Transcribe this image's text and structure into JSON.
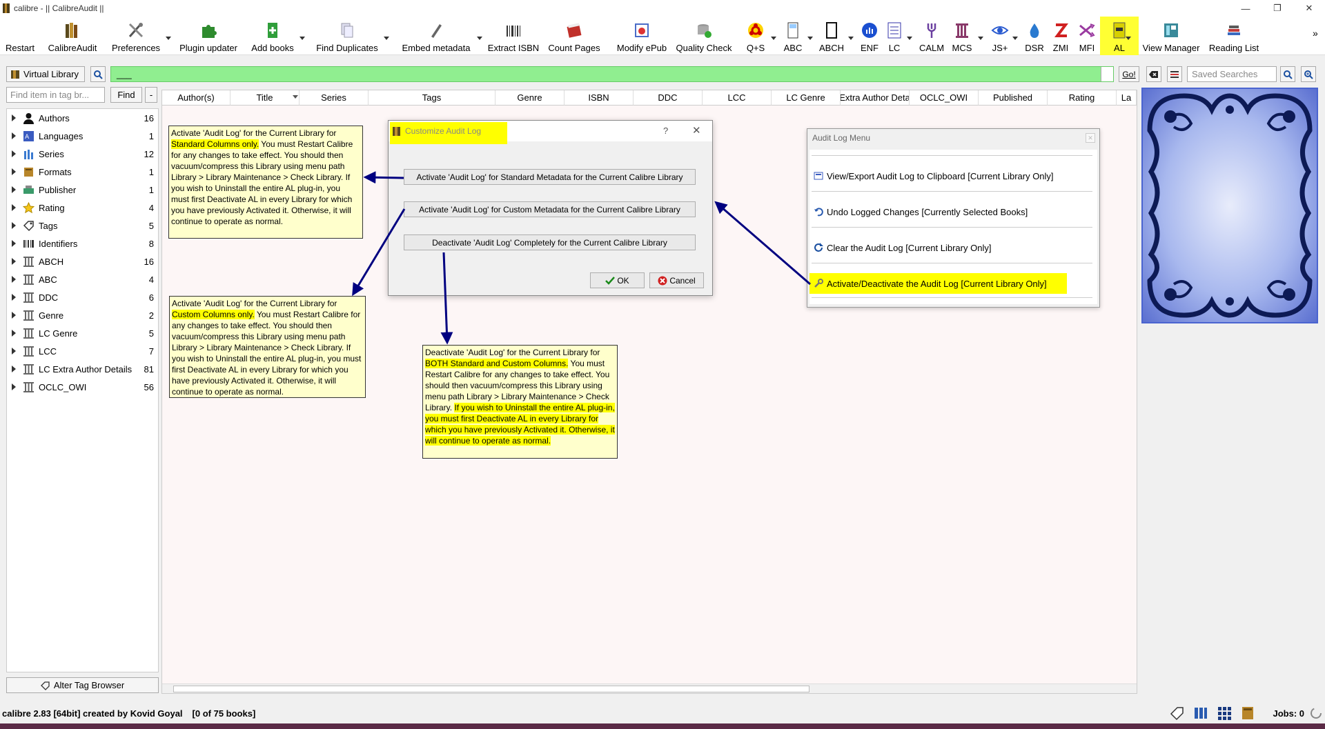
{
  "window": {
    "title": "calibre - || CalibreAudit ||",
    "controls": [
      "—",
      "❐",
      "✕"
    ]
  },
  "toolbar": {
    "restart": "Restart",
    "calibreaudit": "CalibreAudit",
    "preferences": "Preferences",
    "plugin_updater": "Plugin updater",
    "add_books": "Add books",
    "find_duplicates": "Find Duplicates",
    "embed_metadata": "Embed metadata",
    "extract_isbn": "Extract ISBN",
    "count_pages": "Count Pages",
    "modify_epub": "Modify ePub",
    "quality_check": "Quality Check",
    "qs": "Q+S",
    "abc": "ABC",
    "abch": "ABCH",
    "enf": "ENF",
    "lc": "LC",
    "calm": "CALM",
    "mcs": "MCS",
    "js": "JS+",
    "dsr": "DSR",
    "zmi": "ZMI",
    "mfi": "MFI",
    "al": "AL",
    "view_manager": "View Manager",
    "reading_list": "Reading List",
    "overflow": "»"
  },
  "search": {
    "virtual_library": "Virtual Library",
    "query": "___",
    "go": "Go!",
    "saved_placeholder": "Saved Searches"
  },
  "tagbrowser": {
    "find_placeholder": "Find item in tag br...",
    "find": "Find",
    "minus": "-",
    "alter": "Alter Tag Browser",
    "items": [
      {
        "label": "Authors",
        "count": "16",
        "icon": "person-icon"
      },
      {
        "label": "Languages",
        "count": "1",
        "icon": "language-icon"
      },
      {
        "label": "Series",
        "count": "12",
        "icon": "series-icon"
      },
      {
        "label": "Formats",
        "count": "1",
        "icon": "book-icon"
      },
      {
        "label": "Publisher",
        "count": "1",
        "icon": "publisher-icon"
      },
      {
        "label": "Rating",
        "count": "4",
        "icon": "star-icon"
      },
      {
        "label": "Tags",
        "count": "5",
        "icon": "tag-icon"
      },
      {
        "label": "Identifiers",
        "count": "8",
        "icon": "barcode-icon"
      },
      {
        "label": "ABCH",
        "count": "16",
        "icon": "column-icon"
      },
      {
        "label": "ABC",
        "count": "4",
        "icon": "column-icon"
      },
      {
        "label": "DDC",
        "count": "6",
        "icon": "column-icon"
      },
      {
        "label": "Genre",
        "count": "2",
        "icon": "column-icon"
      },
      {
        "label": "LC Genre",
        "count": "5",
        "icon": "column-icon"
      },
      {
        "label": "LCC",
        "count": "7",
        "icon": "column-icon"
      },
      {
        "label": "LC Extra Author Details",
        "count": "81",
        "icon": "column-icon"
      },
      {
        "label": "OCLC_OWI",
        "count": "56",
        "icon": "column-icon"
      }
    ]
  },
  "booklist": {
    "columns": [
      "Author(s)",
      "Title",
      "Series",
      "Tags",
      "Genre",
      "ISBN",
      "DDC",
      "LCC",
      "LC Genre",
      "Extra Author Deta",
      "OCLC_OWI",
      "Published",
      "Rating",
      "La"
    ]
  },
  "dialog": {
    "title": "Customize Audit Log",
    "help": "?",
    "close": "✕",
    "btn_standard": "Activate 'Audit Log' for Standard Metadata for the Current Calibre Library",
    "btn_custom": "Activate 'Audit Log' for Custom Metadata for the Current Calibre Library",
    "btn_deactivate": "Deactivate 'Audit Log' Completely for the Current Calibre Library",
    "ok": "OK",
    "cancel": "Cancel"
  },
  "menu": {
    "title": "Audit Log Menu",
    "items": [
      "View/Export Audit Log to Clipboard [Current Library Only]",
      "Undo Logged Changes [Currently Selected Books]",
      "Clear the Audit Log [Current Library Only]",
      "Activate/Deactivate the Audit Log [Current Library Only]"
    ]
  },
  "notes": {
    "n1": {
      "a": "Activate 'Audit Log' for the Current Library for ",
      "hl": "Standard Columns only.",
      "b": " You must Restart Calibre for any changes to take effect. You should then vacuum/compress this Library using menu path Library > Library Maintenance > Check Library. If you wish to Uninstall the entire AL plug-in, you must first Deactivate AL in every Library for which you have previously Activated it. Otherwise, it will continue to operate as normal."
    },
    "n2": {
      "a": "Activate 'Audit Log' for the Current Library for ",
      "hl": "Custom Columns only.",
      "b": " You must Restart Calibre for any changes to take effect. You should then vacuum/compress this Library using menu path Library > Library Maintenance > Check Library. If you wish to Uninstall the entire AL plug-in, you must first Deactivate AL in every Library for which you have previously Activated it. Otherwise, it will continue to operate as normal."
    },
    "n3": {
      "a": "Deactivate 'Audit Log' for the Current Library for ",
      "hl": "BOTH Standard and Custom Columns.",
      "b": " You must Restart Calibre for any changes to take effect. You should then vacuum/compress this Library using menu path Library > Library Maintenance > Check Library. ",
      "hl2": "If you wish to Uninstall the entire AL plug-in, you must first Deactivate AL in every Library for which you have previously Activated it. Otherwise, it will continue to operate as normal."
    }
  },
  "status": {
    "version": "calibre 2.83 [64bit] created by Kovid Goyal",
    "count": "[0 of 75 books]",
    "jobs": "Jobs: 0"
  },
  "colors": {
    "highlight": "#ffff00",
    "search_bg": "#90ee90",
    "arrow": "#000080",
    "bottom_strip": "#5b2a46"
  }
}
